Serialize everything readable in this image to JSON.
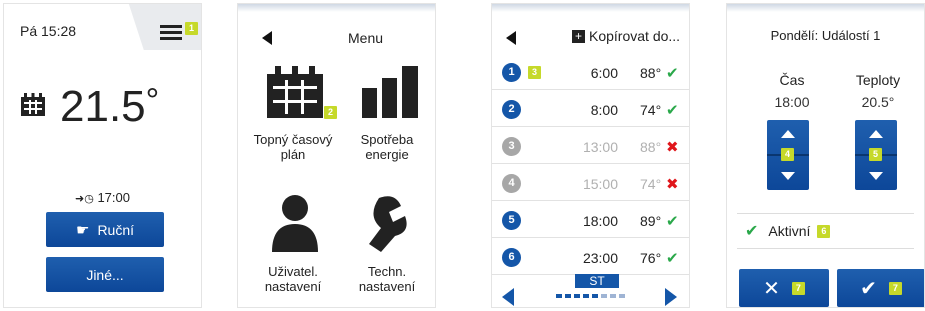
{
  "screen_home": {
    "clock": "Pá 15:28",
    "badge": "1",
    "temperature": "21.5",
    "degree": "°",
    "next_event_time": "17:00",
    "manual_button": "Ruční",
    "other_button": "Jiné..."
  },
  "screen_menu": {
    "title": "Menu",
    "items": [
      {
        "label": "Topný časový plán",
        "badge": "2"
      },
      {
        "label": "Spotřeba energie"
      },
      {
        "label": "Uživatel. nastavení"
      },
      {
        "label": "Techn. nastavení"
      }
    ]
  },
  "screen_schedule": {
    "copy_label": "Kopírovat do...",
    "badge": "3",
    "rows": [
      {
        "num": "1",
        "time": "6:00",
        "temp": "88°",
        "active": true
      },
      {
        "num": "2",
        "time": "8:00",
        "temp": "74°",
        "active": true
      },
      {
        "num": "3",
        "time": "13:00",
        "temp": "88°",
        "active": false
      },
      {
        "num": "4",
        "time": "15:00",
        "temp": "74°",
        "active": false
      },
      {
        "num": "5",
        "time": "18:00",
        "temp": "89°",
        "active": true
      },
      {
        "num": "6",
        "time": "23:00",
        "temp": "76°",
        "active": true
      }
    ],
    "day": "ST"
  },
  "screen_event": {
    "title": "Pondělí: Událostí 1",
    "time_label": "Čas",
    "temp_label": "Teploty",
    "time_value": "18:00",
    "temp_value": "20.5°",
    "time_badge": "4",
    "temp_badge": "5",
    "active_label": "Aktivní",
    "active_badge": "6",
    "cancel_badge": "7",
    "confirm_badge": "7"
  },
  "colors": {
    "primary_blue": "#1456a8",
    "badge_green": "#c6d92a",
    "check_green": "#2aa84a",
    "cross_red": "#e0161b",
    "circle_disabled": "#a7a7a7"
  }
}
